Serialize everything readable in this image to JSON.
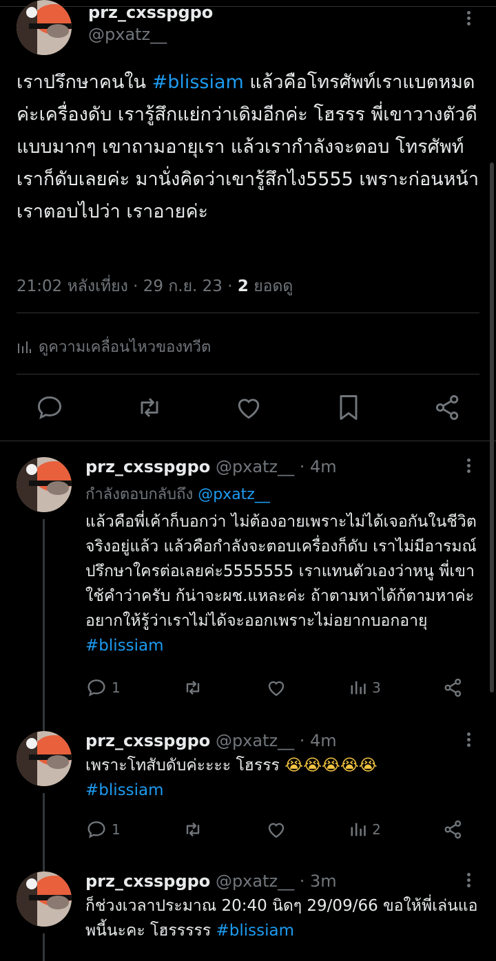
{
  "main_tweet": {
    "display_name": "prz_cxsspgpo",
    "handle": "@pxatz__",
    "text_before": "เราปรึกษาคนใน ",
    "hashtag": "#blissiam",
    "text_after": " แล้วคือโทรศัพท์เราแบตหมดค่ะเครื่องดับ เรารู้สึกแย่กว่าเดิมอีกค่ะ โฮรรร พี่เขาวางตัวดีแบบมากๆ เขาถามอายุเรา แล้วเรากำลังจะตอบ โทรศัพท์เราก็ดับเลยค่ะ มานั่งคิดว่าเขารู้สึกไง5555 เพราะก่อนหน้าเราตอบไปว่า เราอายค่ะ",
    "time": "21:02 หลังเที่ยง",
    "date": "29 ก.ย. 23",
    "views_count": "2",
    "views_label": "ยอดดู",
    "activity_label": "ดูความเคลื่อนไหวของทวีต"
  },
  "replies": [
    {
      "display_name": "prz_cxsspgpo",
      "handle": "@pxatz__",
      "time": "4m",
      "reply_to_label": "กำลังตอบกลับถึง",
      "reply_to_handle": "@pxatz__",
      "text": "แล้วคือพี่เค้าก็บอกว่า ไม่ต้องอายเพราะไม่ได้เจอกันในชีวิตจริงอยู่แล้ว แล้วคือกำลังจะตอบเครื่องก็ดับ เราไม่มีอารมณ์ปรึกษาใครต่อเลยค่ะ5555555  เราแทนตัวเองว่าหนู พี่เขาใช้คำว่าครับ ก้น่าจะผช.แหละค่ะ ถ้าตามหาได้ก้ตามหาค่ะ อยากให้รู้ว่าเราไม่ได้จะออกเพราะไม่อยากบอกอายุ ",
      "hashtag": "#blissiam",
      "reply_count": "1",
      "views_count": "3"
    },
    {
      "display_name": "prz_cxsspgpo",
      "handle": "@pxatz__",
      "time": "4m",
      "text": "เพราะโทสับดับค่ะะะะ โฮรรร ",
      "emoji": "😭😭😭😭😭",
      "hashtag": "#blissiam",
      "reply_count": "1",
      "views_count": "2"
    },
    {
      "display_name": "prz_cxsspgpo",
      "handle": "@pxatz__",
      "time": "3m",
      "text": "ก็ช่วงเวลาประมาณ 20:40 นิดๆ 29/09/66 ขอให้พี่เล่นแอพนี้นะคะ โฮรรรรร ",
      "hashtag": "#blissiam"
    }
  ],
  "colors": {
    "background": "#000000",
    "text": "#e7e9ea",
    "secondary": "#71767b",
    "accent": "#1d9bf0",
    "border": "#2f3336"
  },
  "icons": [
    "more-icon",
    "reply-icon",
    "retweet-icon",
    "like-icon",
    "bookmark-icon",
    "share-icon",
    "views-icon",
    "analytics-icon"
  ]
}
